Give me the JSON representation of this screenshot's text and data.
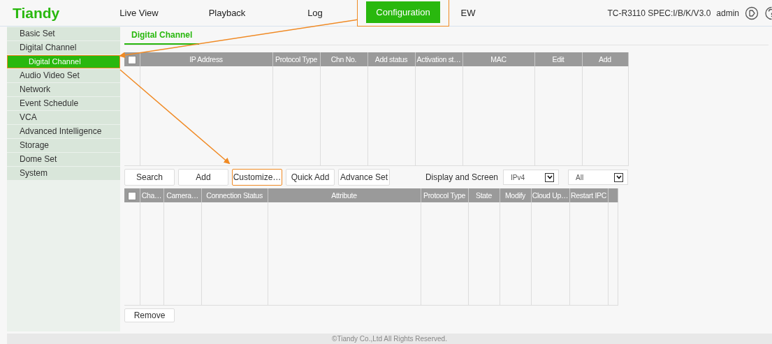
{
  "header": {
    "logo": "Tiandy",
    "nav": [
      {
        "label": "Live View",
        "selected": false,
        "highlighted": false
      },
      {
        "label": "Playback",
        "selected": false,
        "highlighted": false
      },
      {
        "label": "Log",
        "selected": false,
        "highlighted": false
      },
      {
        "label": "Configuration",
        "selected": true,
        "highlighted": true
      },
      {
        "label": "EW",
        "selected": false,
        "highlighted": false
      }
    ],
    "device": "TC-R3110 SPEC:I/B/K/V3.0",
    "user": "admin"
  },
  "sidebar": {
    "items": [
      {
        "label": "Basic Set",
        "selected": false
      },
      {
        "label": "Digital Channel",
        "selected": false,
        "children": [
          {
            "label": "Digital Channel",
            "selected": true,
            "highlighted": true
          }
        ]
      },
      {
        "label": "Audio Video Set",
        "selected": false
      },
      {
        "label": "Network",
        "selected": false
      },
      {
        "label": "Event Schedule",
        "selected": false
      },
      {
        "label": "VCA",
        "selected": false
      },
      {
        "label": "Advanced Intelligence",
        "selected": false
      },
      {
        "label": "Storage",
        "selected": false
      },
      {
        "label": "Dome Set",
        "selected": false
      },
      {
        "label": "System",
        "selected": false
      }
    ]
  },
  "tabs": [
    {
      "label": "Digital Channel",
      "selected": true
    }
  ],
  "device_table": {
    "select_all": {
      "checked": false
    },
    "columns": [
      "IP Address",
      "Protocol Type",
      "Chn No.",
      "Add status",
      "Activation st…",
      "MAC",
      "Edit",
      "Add"
    ]
  },
  "toolbar": {
    "buttons": [
      {
        "label": "Search",
        "highlighted": false
      },
      {
        "label": "Add",
        "highlighted": false
      },
      {
        "label": "Customize…",
        "highlighted": true
      },
      {
        "label": "Quick Add",
        "highlighted": false
      },
      {
        "label": "Advance Set",
        "highlighted": false
      }
    ],
    "display_label": "Display and Screen",
    "selects": [
      {
        "value": "IPv4"
      },
      {
        "value": "All"
      }
    ]
  },
  "channel_table": {
    "select_all": {
      "checked": false
    },
    "columns": [
      "Cha…",
      "Camera…",
      "Connection Status",
      "Attribute",
      "Protocol Type",
      "State",
      "Modify",
      "Cloud Up…",
      "Restart IPC"
    ]
  },
  "actions": {
    "buttons": [
      {
        "label": "Remove"
      }
    ]
  },
  "footer": "©Tiandy Co.,Ltd All Rights Reserved."
}
